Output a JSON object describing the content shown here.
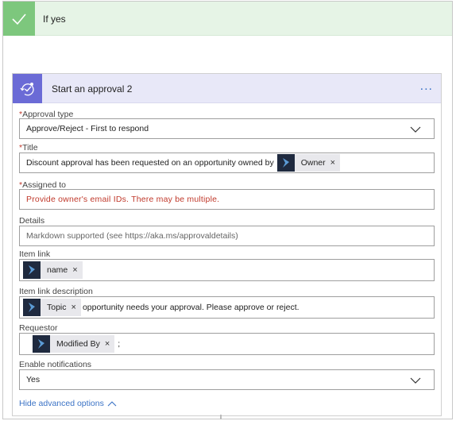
{
  "condition": {
    "label": "If yes"
  },
  "action": {
    "title": "Start an approval 2",
    "more_label": "..."
  },
  "fields": {
    "approval_type": {
      "label": "Approval type",
      "required_mark": "*",
      "value": "Approve/Reject - First to respond"
    },
    "title": {
      "label": "Title",
      "required_mark": "*",
      "text": "Discount approval has been requested on an opportunity owned by",
      "token": "Owner"
    },
    "assigned_to": {
      "label": "Assigned to",
      "required_mark": "*",
      "value": "Provide owner's email IDs. There may be multiple."
    },
    "details": {
      "label": "Details",
      "placeholder": "Markdown supported (see https://aka.ms/approvaldetails)"
    },
    "item_link": {
      "label": "Item link",
      "token": "name"
    },
    "item_link_description": {
      "label": "Item link description",
      "token": "Topic",
      "text": "opportunity needs your approval. Please approve or reject."
    },
    "requestor": {
      "label": "Requestor",
      "token": "Modified By",
      "text": ";"
    },
    "enable_notifications": {
      "label": "Enable notifications",
      "value": "Yes"
    }
  },
  "footer": {
    "hide_advanced_label": "Hide advanced options"
  },
  "token_remove_glyph": "×",
  "colors": {
    "condition_green": "#7dc77d",
    "condition_bg": "#e6f4e6",
    "action_purple": "#6b6bd6",
    "action_bg": "#e8e8f8",
    "error_red": "#c0392b",
    "link_blue": "#3b73c6",
    "token_icon_bg": "#1f2a3f"
  }
}
